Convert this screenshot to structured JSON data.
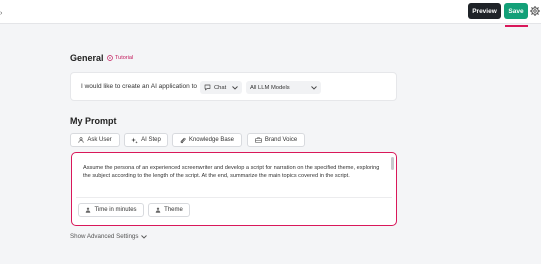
{
  "topbar": {
    "back_icon": "chevron-right-icon",
    "preview_label": "Preview",
    "save_label": "Save",
    "settings_icon": "gear-icon",
    "colors": {
      "preview_bg": "#1f2328",
      "save_bg": "#13a078",
      "accent": "#d9185a"
    }
  },
  "general": {
    "title": "General",
    "tutorial_label": "Tutorial",
    "create_label": "I would like to create an AI application to",
    "app_type": {
      "icon": "chat-bubble-icon",
      "value": "Chat"
    },
    "model": {
      "value": "All LLM Models"
    }
  },
  "prompt": {
    "title": "My Prompt",
    "insert_buttons": [
      {
        "label": "Ask User",
        "icon": "user-icon"
      },
      {
        "label": "AI Step",
        "icon": "sparkle-icon"
      },
      {
        "label": "Knowledge Base",
        "icon": "paperclip-icon"
      },
      {
        "label": "Brand Voice",
        "icon": "briefcase-icon"
      }
    ],
    "text": "Assume the persona of an experienced screenwriter and develop a script for narration on the specified theme, exploring the subject according to the length of the script. At the end, summarize the main topics covered in the script.",
    "variables": [
      {
        "label": "Time in minutes",
        "icon": "user-icon"
      },
      {
        "label": "Theme",
        "icon": "user-icon"
      }
    ]
  },
  "advanced": {
    "label": "Show Advanced Settings"
  }
}
